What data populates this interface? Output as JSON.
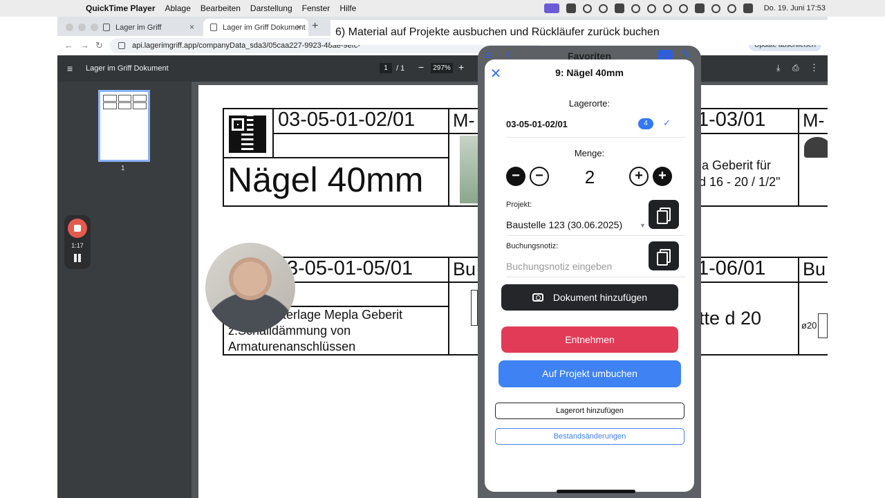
{
  "menubar": {
    "app": "QuickTime Player",
    "items": [
      "Ablage",
      "Bearbeiten",
      "Darstellung",
      "Fenster",
      "Hilfe"
    ],
    "datetime": "Do. 19. Juni  17:53"
  },
  "browser": {
    "tabs": [
      {
        "label": "Lager im Griff"
      },
      {
        "label": "Lager im Griff Dokument"
      }
    ],
    "url": "api.lagerimgriff.app/companyData_sda3/05caa227-9923-48ae-9efc-",
    "update_label": "Update abschließen"
  },
  "pdf": {
    "title": "Lager im Griff Dokument",
    "page_current": "1",
    "page_total": "/ 1",
    "zoom": "297%",
    "thumb_number": "1"
  },
  "recorder": {
    "time": "1:17"
  },
  "labels": {
    "l1_code": "03-05-01-02/01",
    "l1_name": "Nägel 40mm",
    "l2_code": "1-03/01",
    "l2_text1": "la Geberit für",
    "l2_text2": "d 16 - 20 / 1/2\"",
    "mcut1": "M-",
    "mcut2": "M-",
    "l3_code": "3-05-01-05/01",
    "l3_text1": "nterlage Mepla Geberit",
    "l3_text2": "z.Schalldämmung von",
    "l3_text3": "Armaturenanschlüssen",
    "l4_code": "1-06/01",
    "l4_text": "tte d 20",
    "bu1": "Bu",
    "bu2": "Bu",
    "dim": "ø20"
  },
  "caption": "6) Material auf Projekte ausbuchen und Rückläufer zurück buchen",
  "phone": {
    "header_title": "Favoriten",
    "sheet_title": "9: Nägel 40mm",
    "lagerorte_label": "Lagerorte:",
    "location": "03-05-01-02/01",
    "location_badge": "4",
    "menge_label": "Menge:",
    "quantity": "2",
    "projekt_label": "Projekt:",
    "projekt_value": "Baustelle 123 (30.06.2025)",
    "notiz_label": "Buchungsnotiz:",
    "notiz_placeholder": "Buchungsnotiz eingeben",
    "btn_document": "Dokument hinzufügen",
    "btn_take": "Entnehmen",
    "btn_rebook": "Auf Projekt umbuchen",
    "btn_add_location": "Lagerort hinzufügen",
    "btn_changes": "Bestandsänderungen"
  }
}
